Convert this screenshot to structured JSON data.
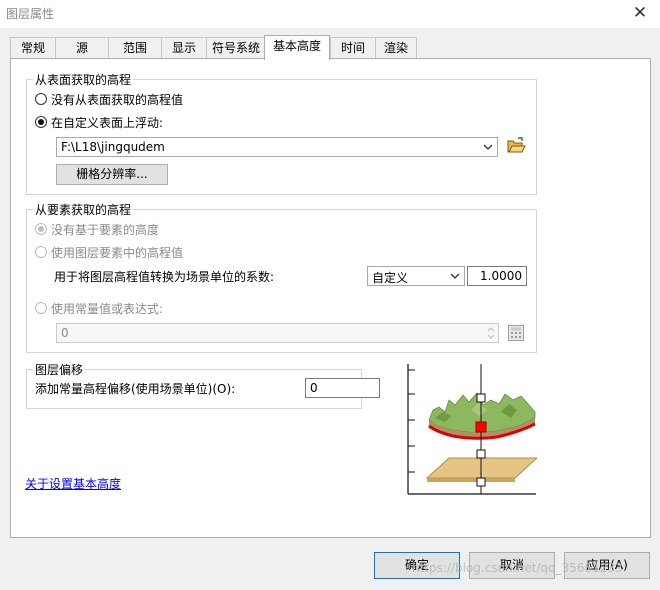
{
  "window": {
    "title": "图层属性",
    "close_symbol": "✕"
  },
  "tabs": [
    {
      "label": "常规"
    },
    {
      "label": "源"
    },
    {
      "label": "范围"
    },
    {
      "label": "显示"
    },
    {
      "label": "符号系统"
    },
    {
      "label": "基本高度",
      "active": true
    },
    {
      "label": "时间"
    },
    {
      "label": "渲染"
    }
  ],
  "surface_group": {
    "legend": "从表面获取的高程",
    "radio_none": "没有从表面获取的高程值",
    "radio_float": "在自定义表面上浮动:",
    "surface_value": "F:\\L18\\jingqudem",
    "raster_resolution_button": "栅格分辨率..."
  },
  "feature_group": {
    "legend": "从要素获取的高程",
    "radio_none": "没有基于要素的高度",
    "radio_layer": "使用图层要素中的高程值",
    "factor_label": "用于将图层高程值转换为场景单位的系数:",
    "unit_select": "自定义",
    "factor_value": "1.0000",
    "radio_expression": "使用常量值或表达式:",
    "expression_value": "0"
  },
  "offset_group": {
    "legend": "图层偏移",
    "label": "添加常量高程偏移(使用场景单位)(O):",
    "value": "0"
  },
  "help_link": "关于设置基本高度",
  "buttons": {
    "ok": "确定",
    "cancel": "取消",
    "apply": "应用(A)"
  },
  "watermark": "https://blog.csdn.net/qq_35661233",
  "colors": {
    "link": "#0000ff",
    "accent": "#0078d7",
    "marker": "#ff0000",
    "surface": "#e00000"
  },
  "icons": {
    "folder": "folder-open-icon",
    "calculator": "expression-builder-icon",
    "diagram": "base-height-diagram"
  }
}
